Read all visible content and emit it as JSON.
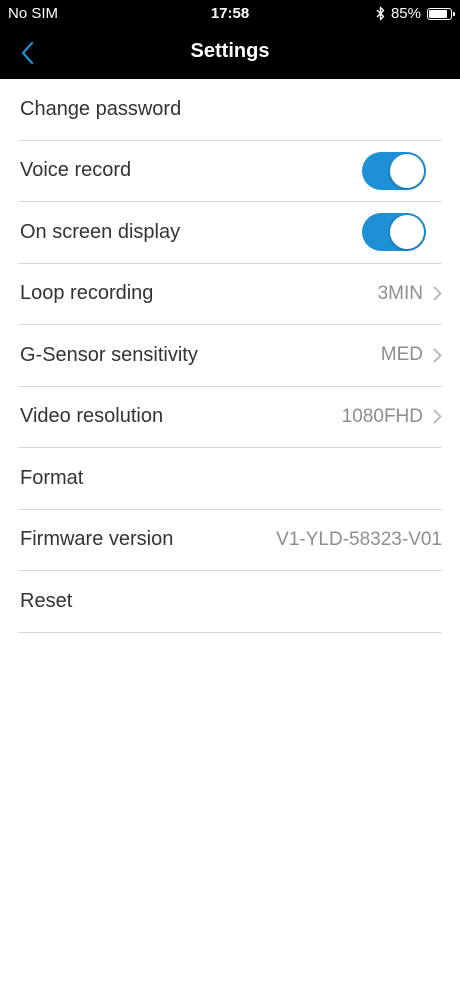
{
  "status_bar": {
    "carrier": "No SIM",
    "time": "17:58",
    "battery": "85%",
    "battery_level": 0.85,
    "bluetooth_icon": "bluetooth-icon"
  },
  "nav": {
    "title": "Settings",
    "back_icon": "chevron-left-icon"
  },
  "colors": {
    "accent": "#1e90d6",
    "header_bg": "#000000"
  },
  "settings": {
    "change_password": {
      "label": "Change password"
    },
    "voice_record": {
      "label": "Voice record",
      "enabled": true
    },
    "on_screen_display": {
      "label": "On screen display",
      "enabled": true
    },
    "loop_recording": {
      "label": "Loop recording",
      "value": "3MIN"
    },
    "g_sensor": {
      "label": "G-Sensor sensitivity",
      "value": "MED"
    },
    "video_resolution": {
      "label": "Video resolution",
      "value": "1080FHD"
    },
    "format": {
      "label": "Format"
    },
    "firmware": {
      "label": "Firmware version",
      "value": "V1-YLD-58323-V01"
    },
    "reset": {
      "label": "Reset"
    }
  }
}
